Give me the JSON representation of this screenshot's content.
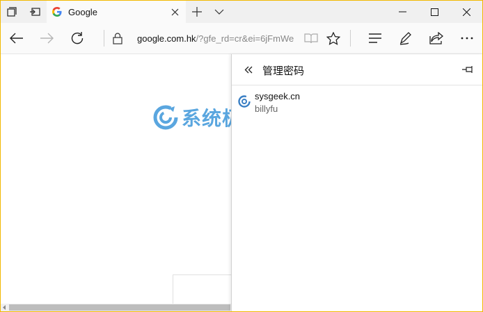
{
  "tabbar": {
    "tab_title": "Google",
    "icons": [
      "set-aside-tabs-icon",
      "tab-preview-icon",
      "google-favicon",
      "close-icon",
      "new-tab-icon",
      "chevron-down-icon"
    ]
  },
  "window_controls": [
    "minimize-icon",
    "maximize-icon",
    "close-icon"
  ],
  "navbar": {
    "url_host": "google.com.hk",
    "url_path": "/?gfe_rd=cr&ei=6jFmWe",
    "icons": [
      "back-icon",
      "forward-icon",
      "refresh-icon",
      "lock-icon",
      "reading-view-icon",
      "favorite-star-icon",
      "hub-icon",
      "web-note-icon",
      "share-icon",
      "more-icon"
    ]
  },
  "watermark": {
    "text": "系统极客"
  },
  "hub": {
    "title": "管理密码",
    "items": [
      {
        "site": "sysgeek.cn",
        "username": "billyfu"
      }
    ]
  },
  "colors": {
    "window_border": "#f2b800",
    "watermark": "#5aa6df",
    "tabbar_bg": "#f0f0f0"
  }
}
